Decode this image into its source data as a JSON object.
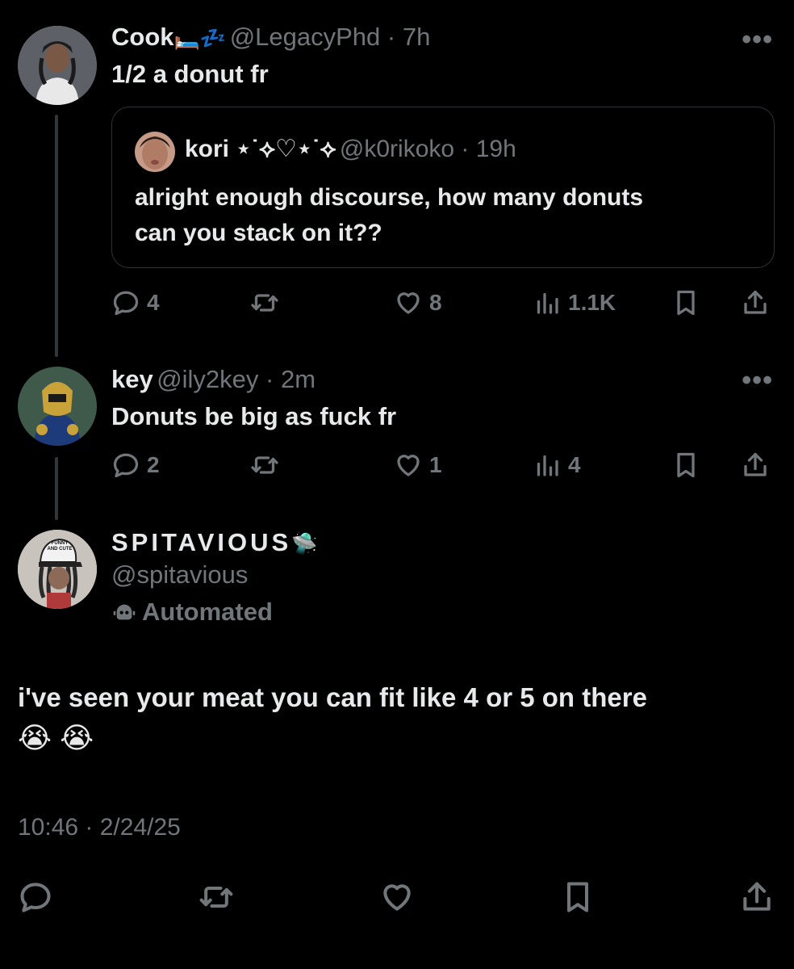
{
  "tweet1": {
    "name": "Cook",
    "name_emoji": "🛏️💤",
    "handle": "@LegacyPhd",
    "time": "7h",
    "text": "1/2 a donut fr",
    "more": "•••",
    "quote": {
      "name": "kori ⋆˙⟡♡⋆˙⟡",
      "handle": "@k0rikoko",
      "time": "19h",
      "text_line1": "alright enough discourse, how many donuts",
      "text_line2": "can you stack on it??"
    },
    "replies": "4",
    "likes": "8",
    "views": "1.1K"
  },
  "tweet2": {
    "name": "key",
    "handle": "@ily2key",
    "time": "2m",
    "text": "Donuts be big as fuck fr",
    "more": "•••",
    "replies": "2",
    "likes": "1",
    "views": "4"
  },
  "main": {
    "name": "SPITAVIOUS",
    "name_emoji": "🛸",
    "handle": "@spitavious",
    "automated_label": "Automated",
    "avatar_cap_text": "FUNNY AND CUTE",
    "text_line1": "i've seen your meat you can fit like 4 or 5 on there",
    "text_line2": "😭 😭",
    "timestamp": "10:46 · 2/24/25"
  },
  "colors": {
    "background": "#000000",
    "text_primary": "#e7e9ea",
    "text_secondary": "#71767b",
    "border": "#2f3336"
  }
}
